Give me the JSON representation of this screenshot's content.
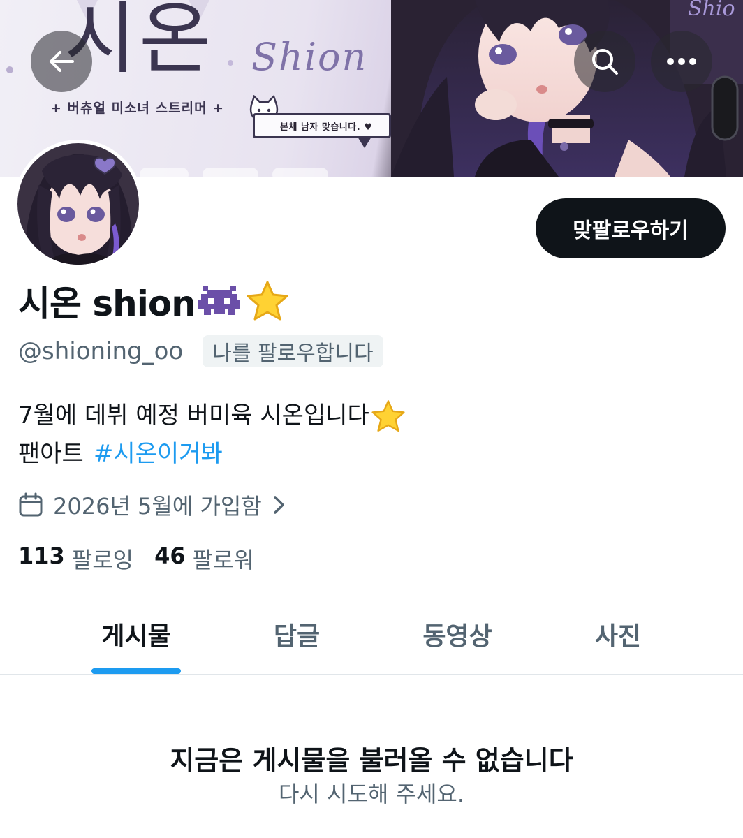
{
  "banner": {
    "title": "시온",
    "script": "Shion",
    "subtitle": "+ 버츄얼 미소녀 스트리머 +",
    "speech": "본체 남자 맞습니다. ♥"
  },
  "header": {
    "back_icon": "arrow-left-icon",
    "search_icon": "search-icon",
    "more_icon": "more-horizontal-icon"
  },
  "profile": {
    "display_name": "시온 shion",
    "name_emojis": [
      "alien-monster-icon",
      "star-icon"
    ],
    "handle": "@shioning_oo",
    "follows_you_badge": "나를 팔로우합니다",
    "follow_back_label": "맞팔로우하기",
    "bio_line1": "7월에 데뷔 예정 버미육 시온입니다",
    "bio_line1_emoji": "star-icon",
    "bio_line2_text": "팬아트",
    "bio_hashtag": "#시온이거봐",
    "joined": "2026년 5월에 가입함",
    "following_count": "113",
    "following_label": "팔로잉",
    "followers_count": "46",
    "followers_label": "팔로워"
  },
  "tabs": [
    {
      "label": "게시물",
      "active": true
    },
    {
      "label": "답글",
      "active": false
    },
    {
      "label": "동영상",
      "active": false
    },
    {
      "label": "사진",
      "active": false
    }
  ],
  "empty_state": {
    "title": "지금은 게시물을 불러올 수 없습니다",
    "subtitle": "다시 시도해 주세요."
  },
  "colors": {
    "accent": "#1d9bf0",
    "text_primary": "#0f1419",
    "text_secondary": "#536471"
  }
}
